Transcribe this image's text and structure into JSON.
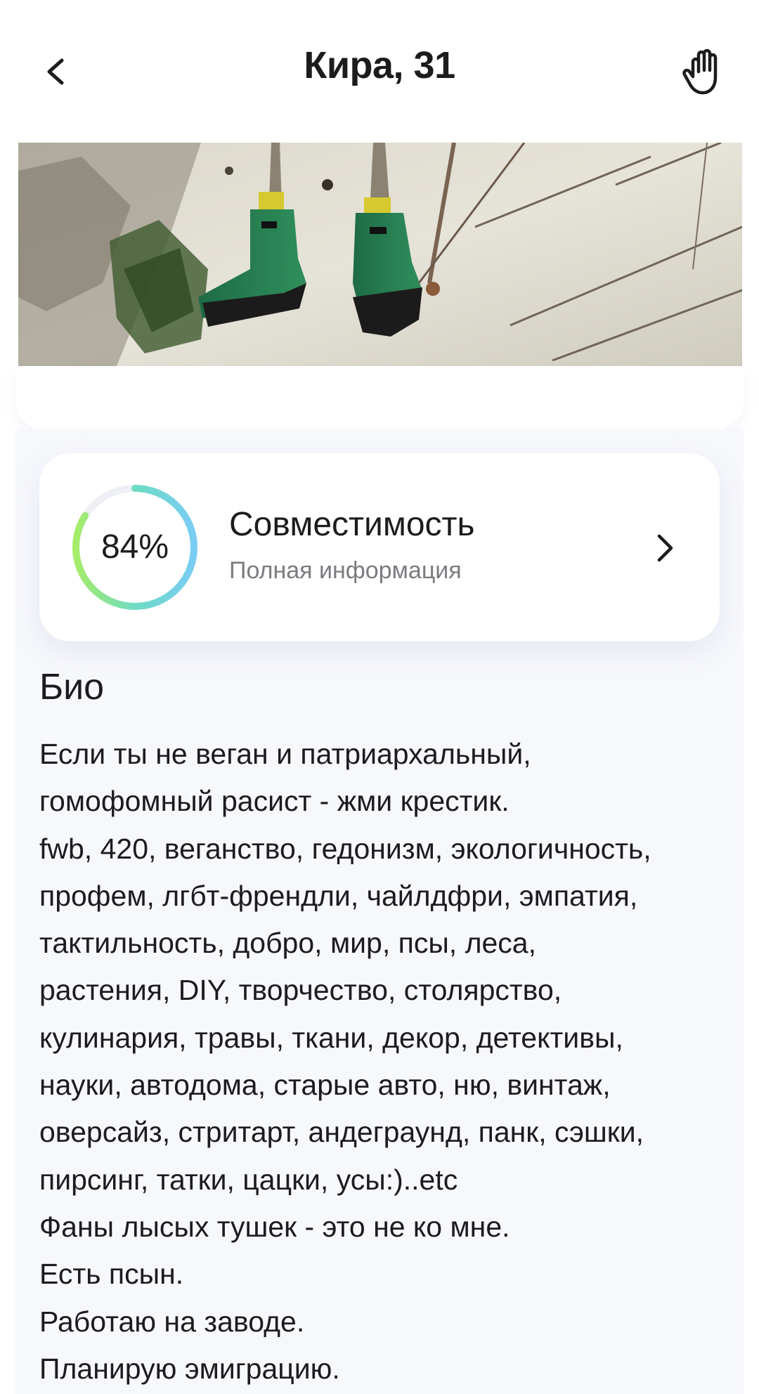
{
  "header": {
    "title": "Кира, 31",
    "back_icon": "chevron-left-icon",
    "wave_icon": "hand-wave-icon"
  },
  "photo": {
    "description_icon": "profile-photo"
  },
  "compatibility": {
    "percent": 84,
    "percent_label": "84%",
    "title": "Совместимость",
    "subtitle": "Полная информация",
    "chevron_icon": "chevron-right-icon",
    "ring_colors": [
      "#a6ec6a",
      "#6edbc3",
      "#79cdf3"
    ],
    "track_color": "#eef0f5"
  },
  "bio": {
    "title": "Био",
    "lines": [
      "Если ты не веган и патриархальный,",
      "гомофомный расист - жми крестик.",
      "fwb, 420, веганство, гедонизм, экологичность,",
      "профем, лгбт-френдли, чайлдфри, эмпатия,",
      "тактильность, добро, мир, псы, леса,",
      "растения, DIY, творчество, столярство,",
      "кулинария, травы, ткани, декор, детективы,",
      "науки, автодома, старые авто, ню, винтаж,",
      "оверсайз, стритарт, андеграунд, панк, сэшки,",
      "пирсинг, татки, цацки, усы:)..etc",
      "Фаны лысых тушек - это не ко мне.",
      "Есть псын.",
      "Работаю на заводе.",
      "Планирую эмиграцию."
    ]
  }
}
